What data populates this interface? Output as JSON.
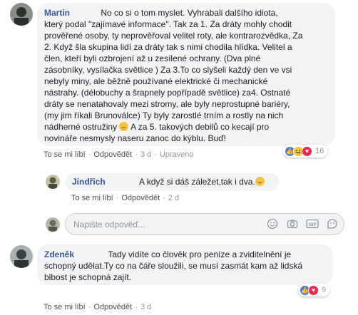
{
  "comments": [
    {
      "author": "Martin",
      "text_intro": "No co si o tom myslet. Vyhrabali dalšího idiota,",
      "lines": [
        "který podal \"zajímavé informace\". Tak za 1. Za dráty mohly chodit",
        "prověřené osoby, ty neprověřoval velitel roty, ale kontrarozvědka, Za",
        "2. Když šla skupina lidí za dráty tak s nimi chodila hlídka. Velitel a",
        "člen, kteří byli ozbrojení až u zesílené ochrany. (Dva plné",
        "zásobníky, vysílačka světlice ) Za 3.To co slyšeli každý den ve vsi",
        "nebyly miny, ale běžně používané elektrické či mechanické",
        "nástrahy. (délobuchy a šrapnely popřípadě světlice) za4. Ostnaté",
        "dráty se nenatahovaly mezi stromy, ale byly neprostupné bariéry,",
        "(my jim říkali Brunoválce) Ty byly zarostlé trním a rostly na nich",
        "nádherné ostružiny",
        "novináře nesmysly naseru zanoc do kýblu. Buď!"
      ],
      "line10_tail": " A za 5. takových debilů co kecají pro",
      "actions": {
        "like": "To se mi líbí",
        "reply": "Odpovědět",
        "time": "3 d",
        "edited": "Upraveno"
      },
      "reaction_count": "16"
    },
    {
      "author": "Jindřich",
      "text": "A když si dáš záležet,tak i dva.",
      "actions": {
        "like": "To se mi líbí",
        "reply": "Odpovědět",
        "time": "2 d"
      }
    },
    {
      "author": "Zdeněk",
      "text_intro": "Tady vidíte co člověk pro peníze a zviditelnění je",
      "lines": [
        "schopný udělat.Ty co na čáře sloužili, se musí zasmát kam až lidská",
        "blbost je schopná zajít."
      ],
      "actions": {
        "like": "To se mi líbí",
        "reply": "Odpovědět",
        "time": "3 d"
      },
      "reaction_count": "9"
    }
  ],
  "reply_box": {
    "placeholder": "Napište odpověď..."
  },
  "icons": {
    "emoji": "smiley-icon",
    "camera": "camera-icon",
    "gif": "gif-icon",
    "sticker": "sticker-icon"
  },
  "colors": {
    "name": "#385898",
    "bubble": "#f2f3f5",
    "like": "#4a76e8",
    "love": "#f0284a",
    "haha": "#f7c33c"
  }
}
